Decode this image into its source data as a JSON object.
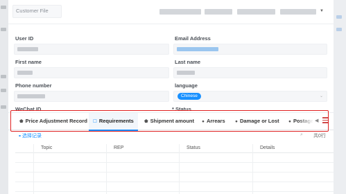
{
  "header": {
    "customer_file_label": "Customer File"
  },
  "form": {
    "user_id": {
      "label": "User ID"
    },
    "email": {
      "label": "Email Address"
    },
    "first_name": {
      "label": "First name"
    },
    "last_name": {
      "label": "Last name"
    },
    "phone": {
      "label": "Phone number"
    },
    "language": {
      "label": "language",
      "value": "Chinese"
    },
    "wechat": {
      "label": "WeChat ID"
    },
    "status": {
      "label": "* Status"
    }
  },
  "tabs": [
    {
      "label": "Price Adjustment Record",
      "icon": "tag-icon",
      "glyph": "⬟"
    },
    {
      "label": "Requirements",
      "icon": "document-icon",
      "glyph": "☐",
      "active": true
    },
    {
      "label": "Shipment amount",
      "icon": "package-icon",
      "glyph": "⬟"
    },
    {
      "label": "Arrears",
      "icon": "info-circle-icon",
      "glyph": "●"
    },
    {
      "label": "Damage or Lost",
      "icon": "info-circle-icon",
      "glyph": "●"
    },
    {
      "label": "Postage",
      "icon": "info-circle-icon",
      "glyph": "●"
    }
  ],
  "toolbar": {
    "select_records_label": "选择记录",
    "count_text": "共0行"
  },
  "table": {
    "columns": [
      "Topic",
      "REP",
      "Status",
      "Details"
    ]
  }
}
